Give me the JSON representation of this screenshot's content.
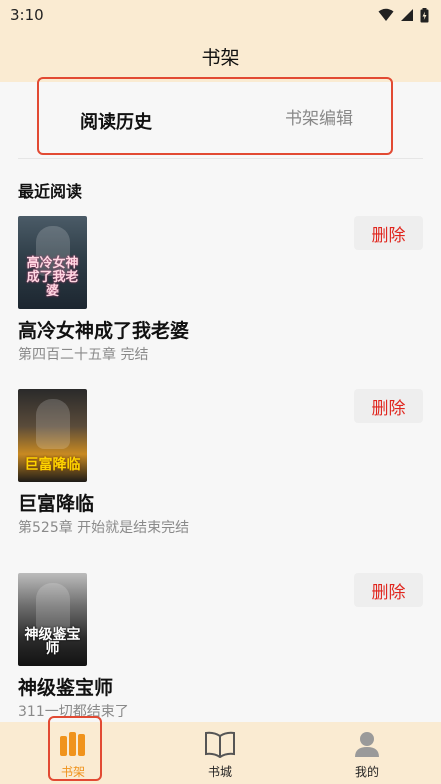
{
  "status_bar": {
    "time": "3:10"
  },
  "header": {
    "title": "书架"
  },
  "tabs": {
    "history": "阅读历史",
    "edit": "书架编辑"
  },
  "section": {
    "title": "最近阅读"
  },
  "books": [
    {
      "title": "高冷女神成了我老婆",
      "progress": "第四百二十五章 完结",
      "cover_text": "高冷女神成了我老婆",
      "delete_label": "删除"
    },
    {
      "title": "巨富降临",
      "progress": "第525章 开始就是结束完结",
      "cover_text": "巨富降临",
      "delete_label": "删除"
    },
    {
      "title": "神级鉴宝师",
      "progress": "311一切都结束了",
      "cover_text": "神级鉴宝师",
      "delete_label": "删除"
    }
  ],
  "bottom_nav": [
    {
      "label": "书架",
      "icon": "bookshelf-icon",
      "active": true
    },
    {
      "label": "书城",
      "icon": "open-book-icon",
      "active": false
    },
    {
      "label": "我的",
      "icon": "person-icon",
      "active": false
    }
  ],
  "colors": {
    "accent": "#f0931c",
    "delete": "#e0261e",
    "bar_bg": "#faebd2",
    "highlight_border": "#e24a33"
  }
}
